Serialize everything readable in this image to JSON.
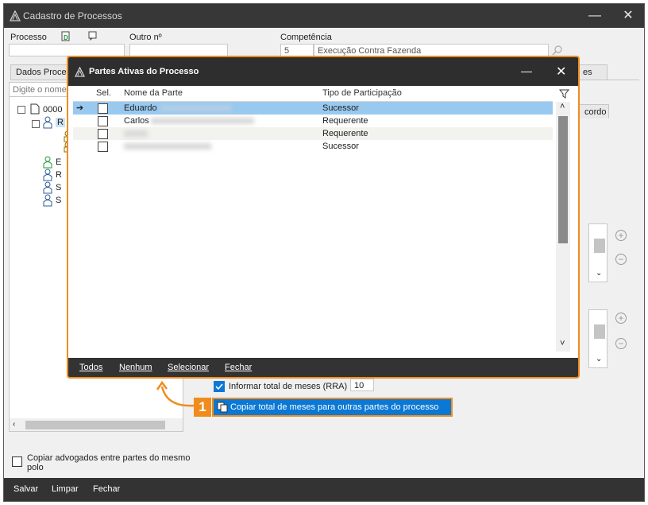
{
  "window": {
    "title": "Cadastro de Processos",
    "minimize": "—",
    "close": "✕"
  },
  "form": {
    "processo_label": "Processo",
    "processo_value": "",
    "outro_label": "Outro nº",
    "outro_value": "",
    "competencia_label": "Competência",
    "competencia_code": "5",
    "competencia_value": "Execução Contra Fazenda"
  },
  "tabs": {
    "dados": "Dados Proce",
    "right_fragment": "es",
    "acordo": "cordo"
  },
  "search": {
    "placeholder": "Digite o nome"
  },
  "tree": {
    "root_label": "0000",
    "children": [
      "R",
      "E",
      "R",
      "S",
      "S"
    ]
  },
  "options": {
    "informar_label": "Informar total de meses (RRA)",
    "informar_value": "10",
    "copy_label": "Copiar total de meses para outras partes do processo",
    "copy_advogados_label": "Copiar advogados entre partes do mesmo polo",
    "callout_number": "1"
  },
  "dialog": {
    "title": "Partes Ativas do Processo",
    "minimize": "—",
    "close": "✕",
    "columns": {
      "sel": "Sel.",
      "nome": "Nome da Parte",
      "tipo": "Tipo de Participação"
    },
    "rows": [
      {
        "nome": "Eduardo",
        "tipo": "Sucessor",
        "selected": true
      },
      {
        "nome": "Carlos",
        "tipo": "Requerente",
        "selected": false
      },
      {
        "nome": "",
        "tipo": "Requerente",
        "selected": false
      },
      {
        "nome": "",
        "tipo": "Sucessor",
        "selected": false
      }
    ],
    "footer": {
      "todos": "Todos",
      "nenhum": "Nenhum",
      "selecionar": "Selecionar",
      "fechar": "Fechar"
    }
  },
  "bottombar": {
    "salvar": "Salvar",
    "limpar": "Limpar",
    "fechar": "Fechar"
  },
  "colors": {
    "accent_orange": "#f08c1e",
    "selection_blue": "#0a78d4",
    "row_highlight": "#99c9ef",
    "title_dark": "#373737"
  }
}
